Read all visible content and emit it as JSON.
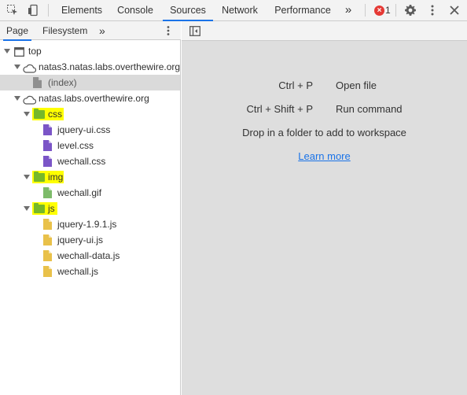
{
  "toolbar": {
    "tabs": [
      "Elements",
      "Console",
      "Sources",
      "Network",
      "Performance"
    ],
    "active_tab": "Sources",
    "more_tabs_symbol": "»",
    "error_count": "1",
    "icons": [
      "inspect-element-icon",
      "device-toolbar-icon",
      "more-tabs-icon",
      "error-icon",
      "settings-icon",
      "more-options-icon",
      "close-icon"
    ]
  },
  "navigator": {
    "tabs": [
      "Page",
      "Filesystem"
    ],
    "active_tab": "Page",
    "more_symbol": "»",
    "tree": {
      "top": "top",
      "origin1": "natas3.natas.labs.overthewire.org",
      "index": "(index)",
      "origin2": "natas.labs.overthewire.org",
      "css_folder": "css",
      "css_files": [
        "jquery-ui.css",
        "level.css",
        "wechall.css"
      ],
      "img_folder": "img",
      "img_files": [
        "wechall.gif"
      ],
      "js_folder": "js",
      "js_files": [
        "jquery-1.9.1.js",
        "jquery-ui.js",
        "wechall-data.js",
        "wechall.js"
      ]
    }
  },
  "editor": {
    "shortcuts": [
      {
        "keys": "Ctrl + P",
        "action": "Open file"
      },
      {
        "keys": "Ctrl + Shift + P",
        "action": "Run command"
      }
    ],
    "drop_text": "Drop in a folder to add to workspace",
    "learn_more": "Learn more"
  },
  "colors": {
    "accent": "#1a73e8",
    "folder": "#76b82a",
    "highlight": "#ffff00",
    "error": "#e53935"
  }
}
